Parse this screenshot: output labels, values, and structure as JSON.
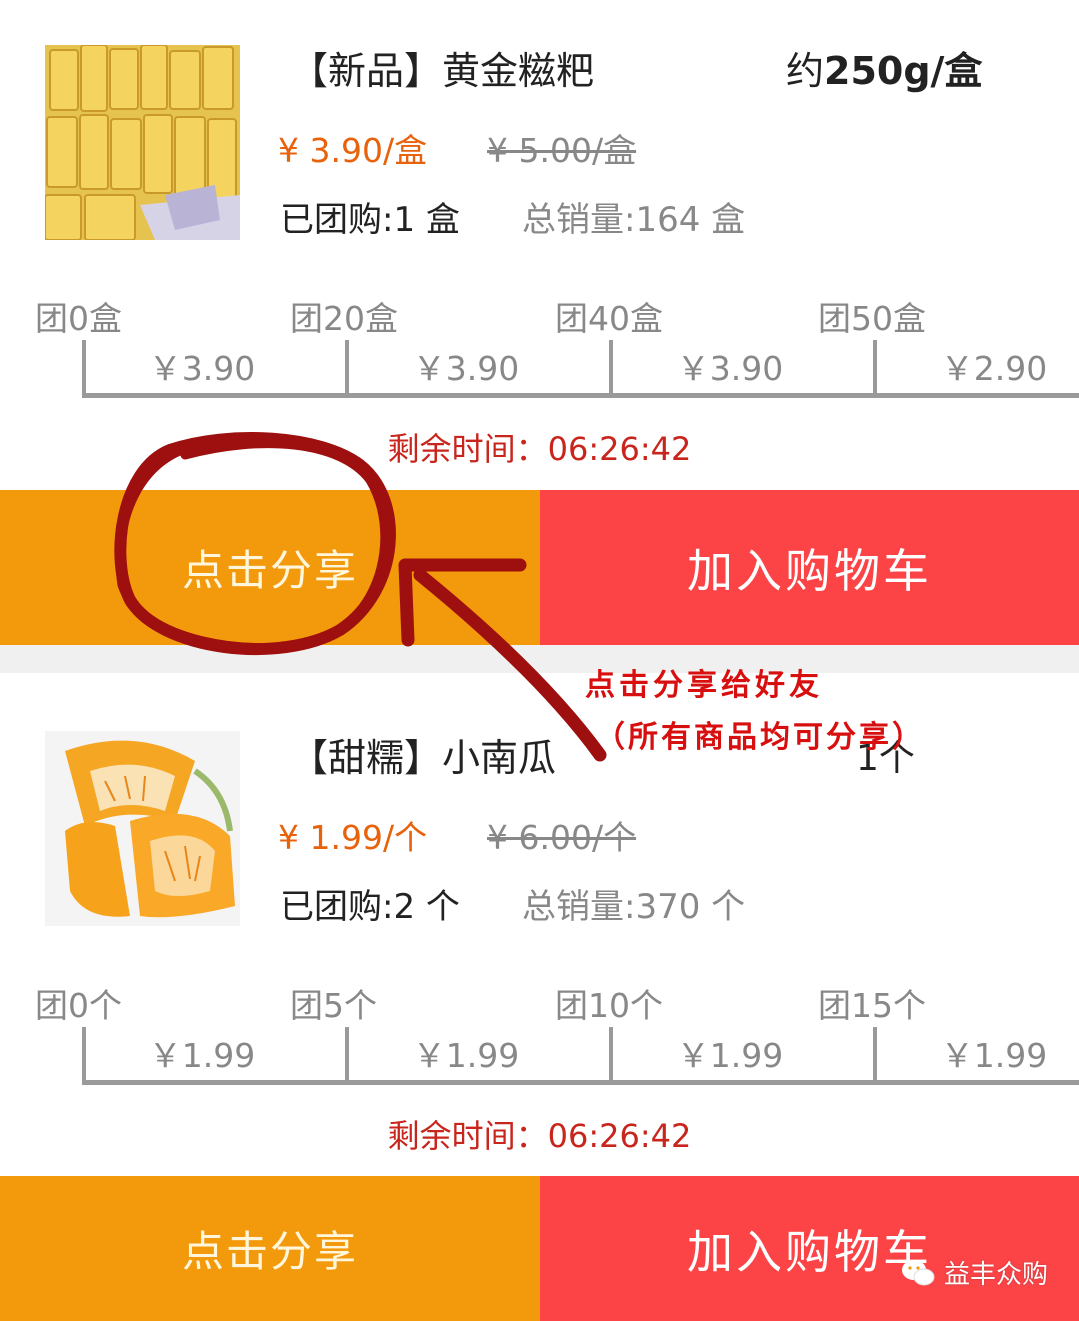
{
  "products": [
    {
      "title": "【新品】黄金糍粑",
      "weight_prefix": "约",
      "weight_value": "250g/盒",
      "price": "¥ 3.90/盒",
      "original_price": "¥ 5.00/盒",
      "bought": "已团购:1 盒",
      "total_sales": "总销量:164 盒",
      "tiers": [
        {
          "label": "团0盒",
          "price": "￥3.90"
        },
        {
          "label": "团20盒",
          "price": "￥3.90"
        },
        {
          "label": "团40盒",
          "price": "￥3.90"
        },
        {
          "label": "团50盒",
          "price": "￥2.90"
        }
      ],
      "countdown": "剩余时间：06:26:42",
      "share_label": "点击分享",
      "cart_label": "加入购物车",
      "image": "golden-rice-cake-photo"
    },
    {
      "title": "【甜糯】小南瓜",
      "quantity": "1个",
      "price": "¥ 1.99/个",
      "original_price": "¥ 6.00/个",
      "bought": "已团购:2 个",
      "total_sales": "总销量:370 个",
      "tiers": [
        {
          "label": "团0个",
          "price": "￥1.99"
        },
        {
          "label": "团5个",
          "price": "￥1.99"
        },
        {
          "label": "团10个",
          "price": "￥1.99"
        },
        {
          "label": "团15个",
          "price": "￥1.99"
        }
      ],
      "countdown": "剩余时间：06:26:42",
      "share_label": "点击分享",
      "cart_label": "加入购物车",
      "image": "small-pumpkin-photo"
    }
  ],
  "annotation": {
    "line1": "点击分享给好友",
    "line2": "（所有商品均可分享）",
    "color": "#d80f0f"
  },
  "watermark": {
    "icon": "wechat-icon",
    "text": "益丰众购"
  },
  "colors": {
    "share_button": "#f39a0c",
    "cart_button": "#fc4447",
    "price": "#e8620c",
    "countdown": "#c8251d"
  }
}
